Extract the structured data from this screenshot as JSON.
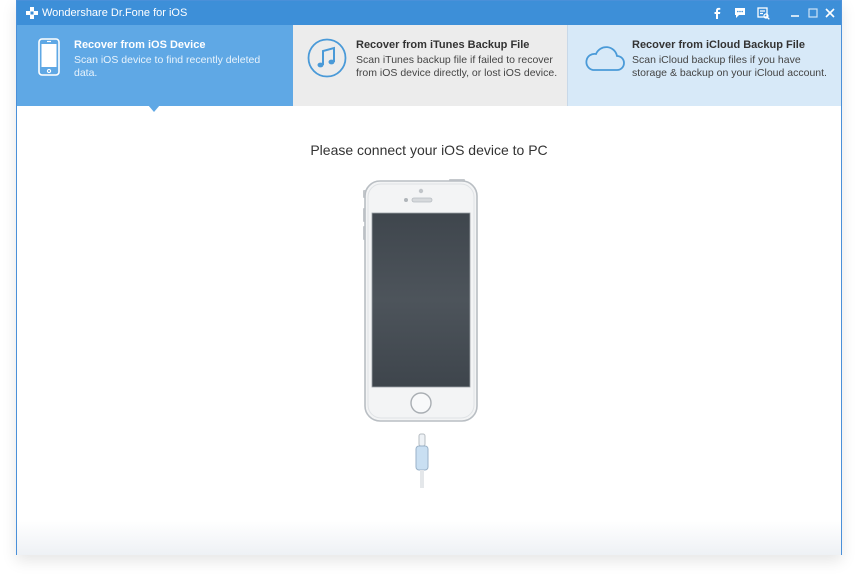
{
  "window": {
    "title": "Wondershare Dr.Fone for iOS",
    "controls": [
      "facebook-icon",
      "feedback-icon",
      "register-icon",
      "minimize-icon",
      "maximize-icon",
      "close-icon"
    ]
  },
  "tabs": [
    {
      "title": "Recover from iOS Device",
      "desc": "Scan iOS device to find recently deleted data.",
      "icon": "phone-icon",
      "selected": true
    },
    {
      "title": "Recover from iTunes Backup File",
      "desc": "Scan iTunes backup file if failed to recover from iOS device directly, or lost iOS device.",
      "icon": "music-note-icon",
      "selected": false
    },
    {
      "title": "Recover from iCloud Backup File",
      "desc": "Scan iCloud backup files if you have storage & backup on your iCloud account.",
      "icon": "cloud-icon",
      "selected": false
    }
  ],
  "main": {
    "prompt": "Please connect your iOS device to PC"
  },
  "colors": {
    "titlebar": "#3d8fd8",
    "selected_tab": "#5fa8e5",
    "tab_inactive": "#ececec",
    "tab_cloud": "#d7e9f8"
  }
}
